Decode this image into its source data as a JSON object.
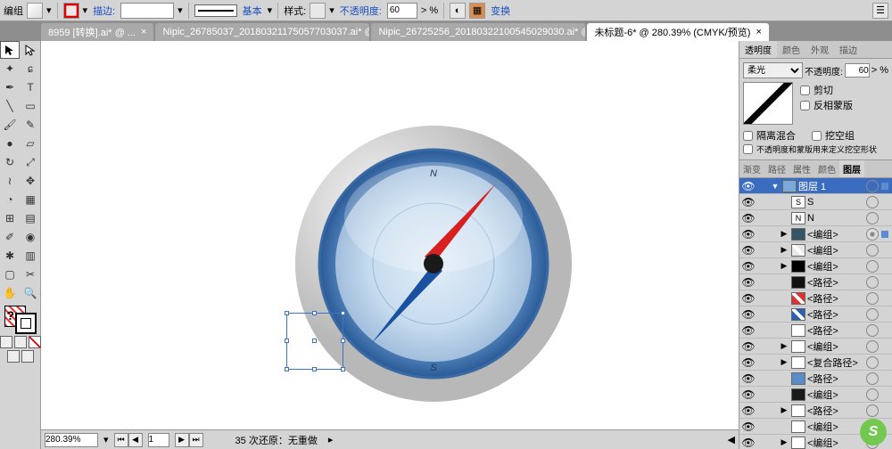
{
  "optbar": {
    "selection_label": "编组",
    "stroke_label": "描边:",
    "basic_label": "基本",
    "style_label": "样式:",
    "opacity_label": "不透明度:",
    "opacity_value": "60",
    "opacity_unit": "> %",
    "transform_label": "变换"
  },
  "tabs": [
    {
      "label": "8959 [转换].ai* @ ..."
    },
    {
      "label": "Nipic_26785037_20180321175057703037.ai* @"
    },
    {
      "label": "Nipic_26725256_20180322100545029030.ai* @"
    },
    {
      "label": "未标题-6* @ 280.39% (CMYK/预览)"
    }
  ],
  "active_tab": 3,
  "status": {
    "zoom": "280.39%",
    "artboard": "1",
    "undo_text": "35 次还原：无重做"
  },
  "transparency": {
    "tabs": [
      "透明度",
      "颜色",
      "外观",
      "描边"
    ],
    "blend_mode": "柔光",
    "opacity_label": "不透明度:",
    "opacity_value": "60",
    "opacity_unit": "> %",
    "clip_label": "剪切",
    "invert_label": "反相蒙版",
    "isolate_label": "隔离混合",
    "knockout_label": "挖空组",
    "alpha_label": "不透明度和蒙版用来定义挖空形状"
  },
  "layers_tabs": [
    "渐变",
    "路径",
    "属性",
    "颜色",
    "图层"
  ],
  "layers_active_tab": 4,
  "layers": [
    {
      "depth": 0,
      "expand": "▼",
      "name": "图层 1",
      "thumb": "#7aa8d8",
      "hdr": true,
      "selSq": "#5b8bd0"
    },
    {
      "depth": 1,
      "expand": "",
      "name": "S",
      "thumb": "#fff",
      "box": "S"
    },
    {
      "depth": 1,
      "expand": "",
      "name": "N",
      "thumb": "#fff",
      "box": "N"
    },
    {
      "depth": 1,
      "expand": "▶",
      "name": "<编组>",
      "thumb": "#356",
      "target": true,
      "selSq": "#5b8bd0"
    },
    {
      "depth": 1,
      "expand": "▶",
      "name": "<编组>",
      "thumb": "#e8e8e8",
      "slash": true
    },
    {
      "depth": 1,
      "expand": "▶",
      "name": "<编组>",
      "thumb": "#000"
    },
    {
      "depth": 1,
      "expand": "",
      "name": "<路径>",
      "thumb": "#111"
    },
    {
      "depth": 1,
      "expand": "",
      "name": "<路径>",
      "thumb": "#e03030",
      "slash": true
    },
    {
      "depth": 1,
      "expand": "",
      "name": "<路径>",
      "thumb": "#2a60b0",
      "slash": true
    },
    {
      "depth": 1,
      "expand": "",
      "name": "<路径>",
      "thumb": "#fff"
    },
    {
      "depth": 1,
      "expand": "▶",
      "name": "<编组>",
      "thumb": "#fff"
    },
    {
      "depth": 1,
      "expand": "▶",
      "name": "<复合路径>",
      "thumb": "#fff"
    },
    {
      "depth": 1,
      "expand": "",
      "name": "<路径>",
      "thumb": "#5a8cc8"
    },
    {
      "depth": 1,
      "expand": "",
      "name": "<编组>",
      "thumb": "#1a1a1a"
    },
    {
      "depth": 1,
      "expand": "▶",
      "name": "<路径>",
      "thumb": "#fff"
    },
    {
      "depth": 1,
      "expand": "",
      "name": "<编组>",
      "thumb": "#fff"
    },
    {
      "depth": 1,
      "expand": "▶",
      "name": "<编组>",
      "thumb": "#fff"
    }
  ],
  "compass": {
    "N": "N",
    "S": "S"
  }
}
